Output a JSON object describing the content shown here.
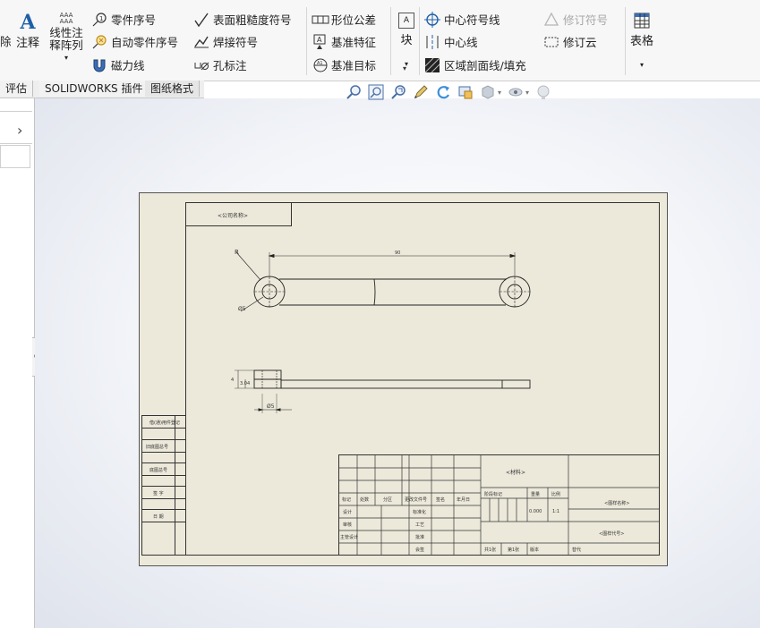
{
  "ribbon": {
    "cut_label": "除",
    "annotation_label": "注释",
    "linear_pattern_label1": "线性注",
    "linear_pattern_label2": "释阵列",
    "balloon": "零件序号",
    "auto_balloon": "自动零件序号",
    "magnetic_line": "磁力线",
    "surface_finish": "表面粗糙度符号",
    "weld_symbol": "焊接符号",
    "hole_callout": "孔标注",
    "geometric_tolerance": "形位公差",
    "datum_feature": "基准特征",
    "datum_target": "基准目标",
    "block_label": "块",
    "center_mark": "中心符号线",
    "centerline": "中心线",
    "area_hatch": "区域剖面线/填充",
    "revision_symbol": "修订符号",
    "revision_cloud": "修订云",
    "table_label": "表格"
  },
  "tabs": [
    "评估",
    "SOLIDWORKS 插件",
    "图纸格式"
  ],
  "icons": {
    "zoom_fit": "zoom-to-fit-icon",
    "zoom_area": "zoom-area-icon",
    "zoom_select": "zoom-selection-icon",
    "rotate": "rotate-view-icon"
  },
  "drawing": {
    "title_box": "<公司名称>",
    "dim_length": "90",
    "dim_r": "R",
    "dim_dia": "Ø5",
    "dim_h1": "4",
    "dim_h2": "3.04",
    "dim_bottom": "Ø5",
    "left_labels": [
      "借(通)用件登记",
      "旧底图总号",
      "底图总号",
      "签 字",
      "日 期"
    ],
    "title_block": {
      "material": "<材料>",
      "drawing_name": "<图样名称>",
      "drawing_no": "<图样代号>",
      "stage_mark": "阶段标记",
      "weight": "重量",
      "scale": "比例",
      "weight_val": "0.000",
      "scale_val": "1:1",
      "sheet_total": "共1张",
      "sheet_no": "第1张",
      "version": "版本",
      "replace": "替代",
      "row_labels": [
        "标记",
        "处数",
        "分区",
        "更改文件号",
        "签名",
        "年月日"
      ],
      "design": "设计",
      "standardization": "标准化",
      "check": "审核",
      "process": "工艺",
      "chief": "主管设计",
      "approve": "批准",
      "countersign": "会签"
    }
  }
}
